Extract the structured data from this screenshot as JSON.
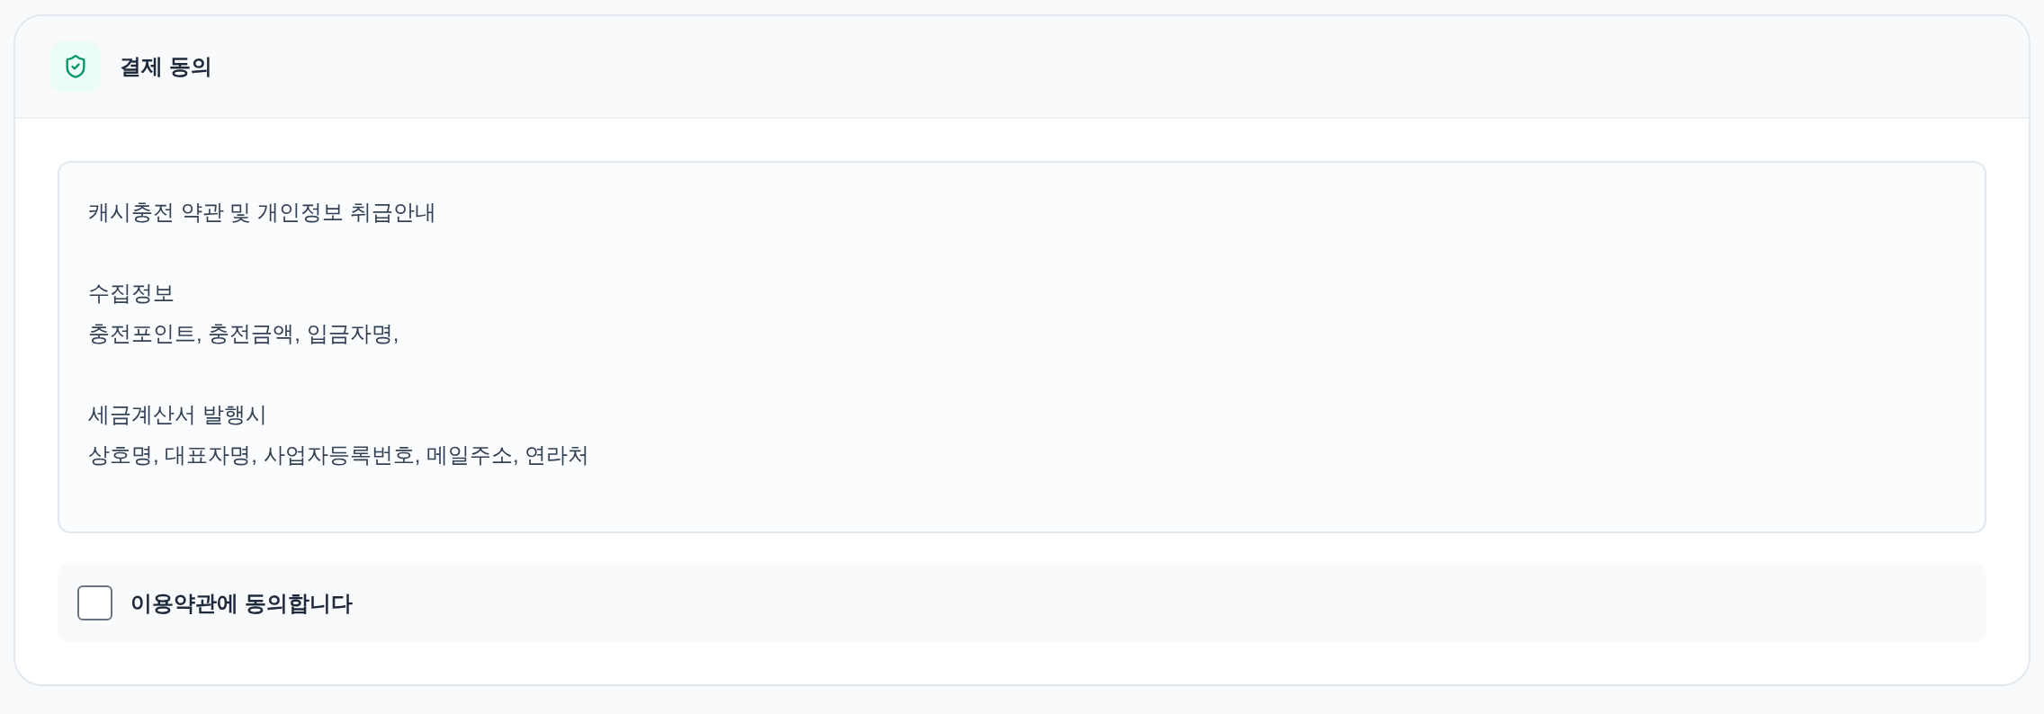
{
  "card": {
    "title": "결제 동의"
  },
  "terms": {
    "title": "캐시충전 약관 및 개인정보 취급안내",
    "sections": [
      {
        "heading": "수집정보",
        "text": "충전포인트, 충전금액, 입금자명,"
      },
      {
        "heading": "세금계산서 발행시",
        "text": "상호명, 대표자명, 사업자등록번호, 메일주소, 연라처"
      }
    ]
  },
  "agreement": {
    "label": "이용약관에 동의합니다",
    "checked": false
  }
}
